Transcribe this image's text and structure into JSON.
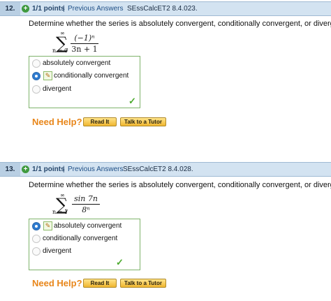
{
  "questions": [
    {
      "number": "12.",
      "points": "1/1 points",
      "separator": "|",
      "previous_answers": "Previous Answers",
      "code": "SEssCalcET2 8.4.023.",
      "prompt": "Determine whether the series is absolutely convergent, conditionally convergent, or divergent.",
      "series": {
        "upper": "∞",
        "lower": "n = 0",
        "numerator": "(−1)ⁿ",
        "denominator": "3n + 1"
      },
      "options": [
        "absolutely convergent",
        "conditionally convergent",
        "divergent"
      ],
      "selected_option": "conditionally convergent",
      "need_help": "Need Help?",
      "read_it": "Read It",
      "talk_to_tutor": "Talk to a Tutor"
    },
    {
      "number": "13.",
      "points": "1/1 points",
      "separator": "|",
      "previous_answers": "Previous Answers",
      "code": "SEssCalcET2 8.4.028.",
      "prompt": "Determine whether the series is absolutely convergent, conditionally convergent, or divergent.",
      "series": {
        "upper": "∞",
        "lower": "n = 1",
        "numerator": "sin 7n",
        "denominator": "8ⁿ"
      },
      "options": [
        "absolutely convergent",
        "conditionally convergent",
        "divergent"
      ],
      "selected_option": "absolutely convergent",
      "need_help": "Need Help?",
      "read_it": "Read It",
      "talk_to_tutor": "Talk to a Tutor"
    }
  ],
  "icons": {
    "plus": "plus-circle-icon",
    "pencil": "pencil-icon",
    "check": "checkmark-icon"
  },
  "colors": {
    "header_bg": "#d3e3f1",
    "correct_green": "#4caa2e",
    "need_help_orange": "#e8861a",
    "button_gold": "#f0b62f"
  }
}
